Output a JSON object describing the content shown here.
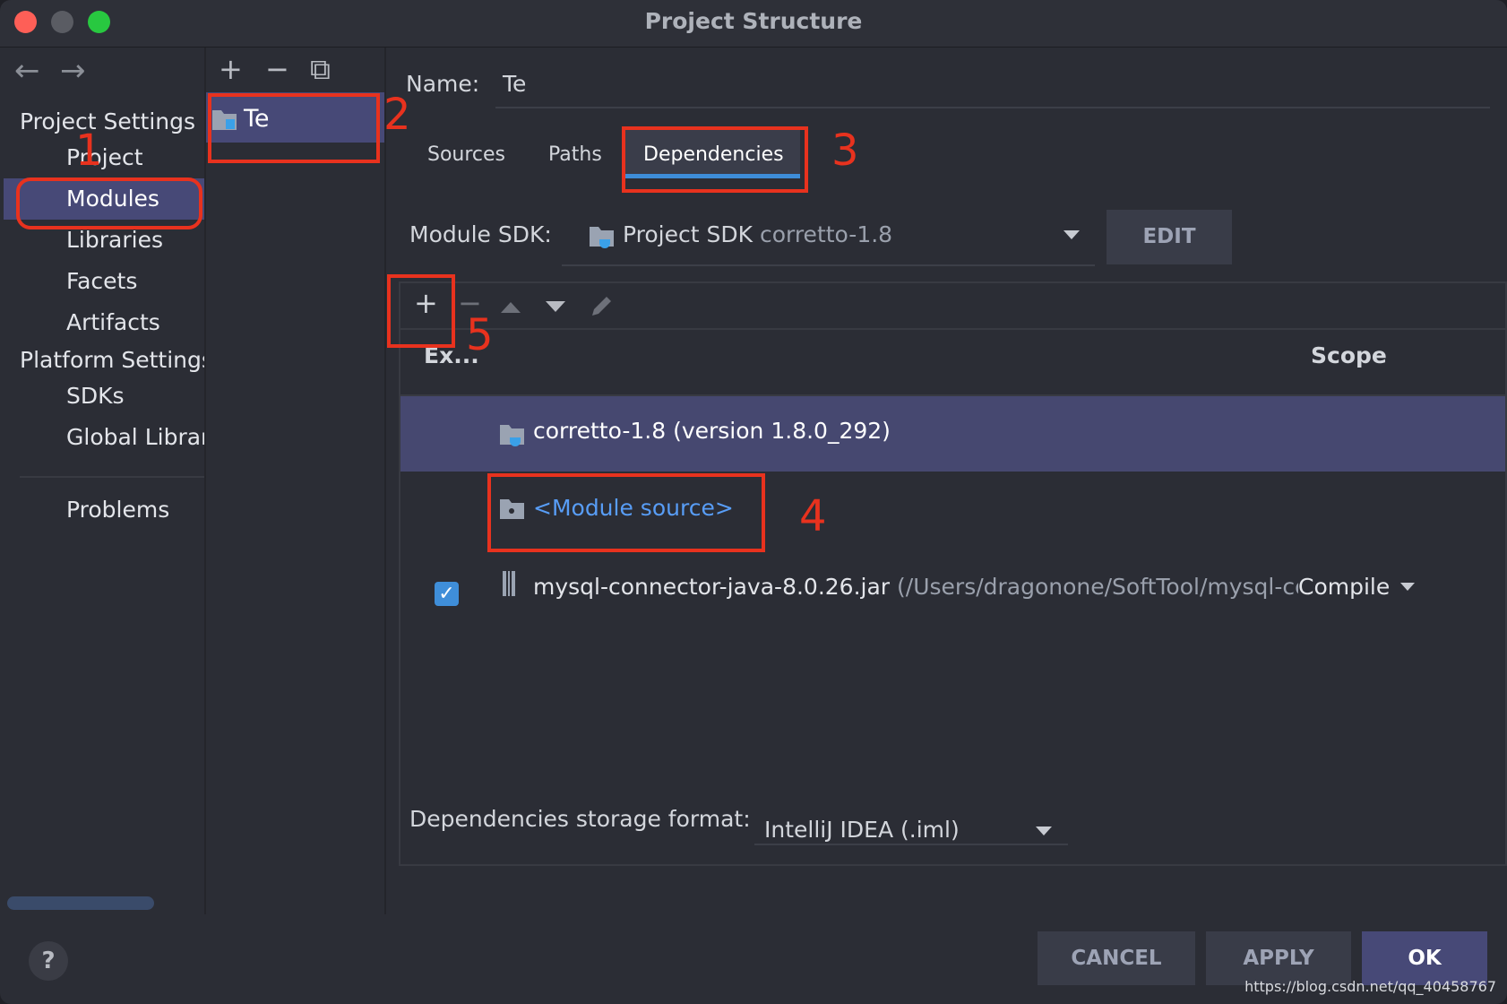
{
  "window": {
    "title": "Project Structure"
  },
  "nav": {
    "back_glyph": "←",
    "forward_glyph": "→",
    "project_settings_label": "Project Settings",
    "project_settings_items": [
      "Project",
      "Modules",
      "Libraries",
      "Facets",
      "Artifacts"
    ],
    "platform_settings_label": "Platform Settings",
    "platform_settings_items": [
      "SDKs",
      "Global Libraries"
    ],
    "problems_label": "Problems",
    "selected": "Modules"
  },
  "module_list": {
    "add_glyph": "+",
    "remove_glyph": "−",
    "copy_glyph": "⧉",
    "items": [
      "Te"
    ]
  },
  "main": {
    "name_label": "Name:",
    "name_value": "Te",
    "tabs": [
      "Sources",
      "Paths",
      "Dependencies"
    ],
    "active_tab": "Dependencies",
    "sdk_label": "Module SDK:",
    "sdk_value": "Project SDK",
    "sdk_detail": "corretto-1.8",
    "edit_label": "EDIT",
    "toolbar": {
      "add": "+",
      "remove": "−",
      "up": "▲",
      "down": "▼",
      "edit": "✎"
    },
    "columns": {
      "export": "Ex...",
      "scope": "Scope"
    },
    "rows": [
      {
        "name": "corretto-1.8 (version 1.8.0_292)",
        "icon": "sdk-folder-icon"
      },
      {
        "name": "<Module source>",
        "icon": "module-source-folder-icon"
      },
      {
        "name": "mysql-connector-java-8.0.26.jar",
        "path": "(/Users/dragonone/SoftTool/mysql-conn",
        "scope": "Compile",
        "checked": true,
        "icon": "jar-icon"
      }
    ],
    "storage_label": "Dependencies storage format:",
    "storage_value": "IntelliJ IDEA (.iml)"
  },
  "footer": {
    "help": "?",
    "cancel": "CANCEL",
    "apply": "APPLY",
    "ok": "OK",
    "watermark": "https://blog.csdn.net/qq_40458767"
  },
  "annotations": [
    "1",
    "2",
    "3",
    "4",
    "5"
  ],
  "colors": {
    "window_bg": "#2b2d35",
    "selection": "#474977",
    "accent_blue": "#3e8dd8",
    "link_blue": "#589df6",
    "annotation_red": "#e8321e"
  }
}
